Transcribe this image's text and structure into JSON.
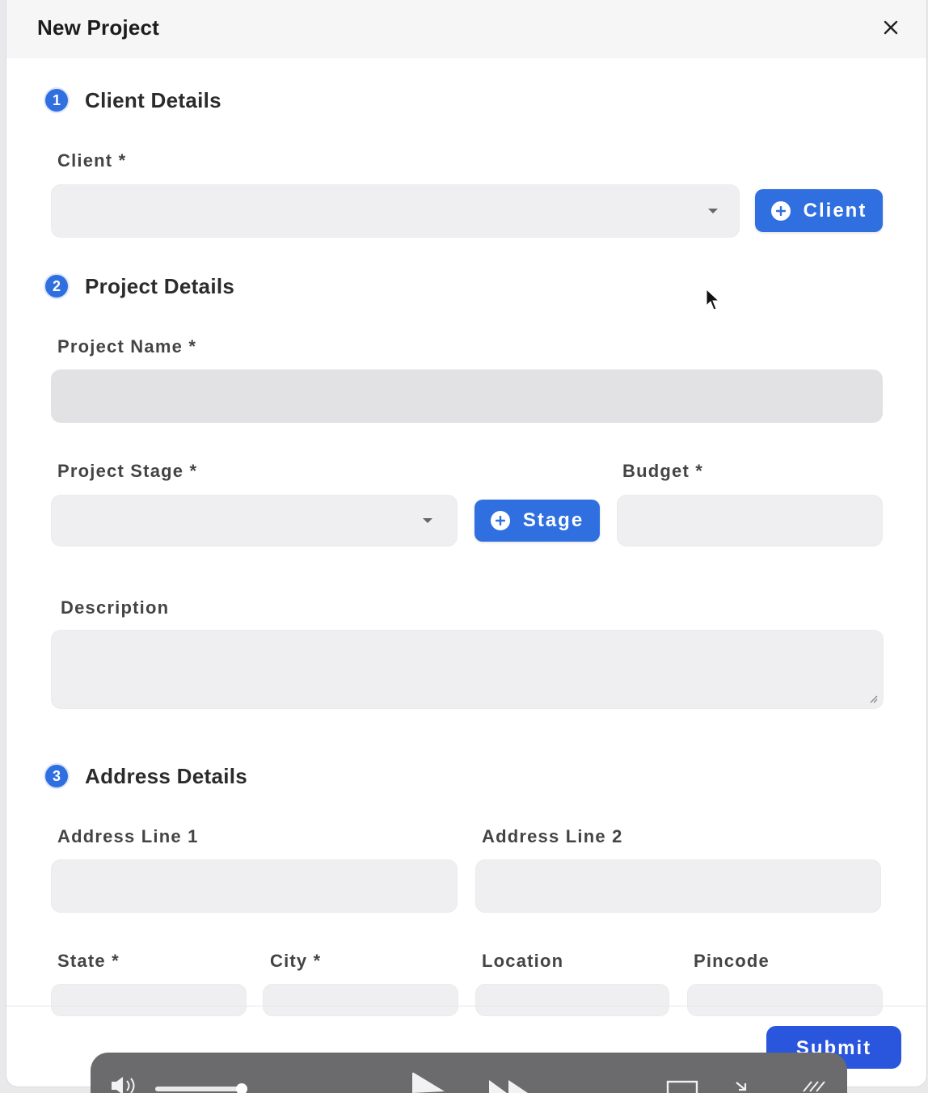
{
  "modal": {
    "title": "New Project",
    "close_icon": "close-icon"
  },
  "sections": {
    "client": {
      "step": "1",
      "title": "Client Details"
    },
    "project": {
      "step": "2",
      "title": "Project Details"
    },
    "address": {
      "step": "3",
      "title": "Address Details"
    }
  },
  "fields": {
    "client": {
      "label": "Client *",
      "value": ""
    },
    "project_name": {
      "label": "Project Name *",
      "value": ""
    },
    "project_stage": {
      "label": "Project Stage *",
      "value": ""
    },
    "budget": {
      "label": "Budget *",
      "value": ""
    },
    "description": {
      "label": "Description",
      "value": ""
    },
    "address_line_1": {
      "label": "Address Line 1",
      "value": ""
    },
    "address_line_2": {
      "label": "Address Line 2",
      "value": ""
    },
    "state": {
      "label": "State *",
      "value": ""
    },
    "city": {
      "label": "City *",
      "value": ""
    },
    "location": {
      "label": "Location",
      "value": ""
    },
    "pincode": {
      "label": "Pincode",
      "value": ""
    }
  },
  "buttons": {
    "add_client": "Client",
    "add_stage": "Stage",
    "submit": "Submit"
  },
  "colors": {
    "accent": "#2f6fe0",
    "submit": "#2a55dd",
    "field_bg": "#efeff1"
  },
  "video_player": {
    "icons": [
      "volume-icon",
      "volume-slider",
      "play-icon",
      "fast-forward-icon",
      "fullscreen-icon",
      "exit-pip-icon",
      "chevrons-icon"
    ]
  }
}
